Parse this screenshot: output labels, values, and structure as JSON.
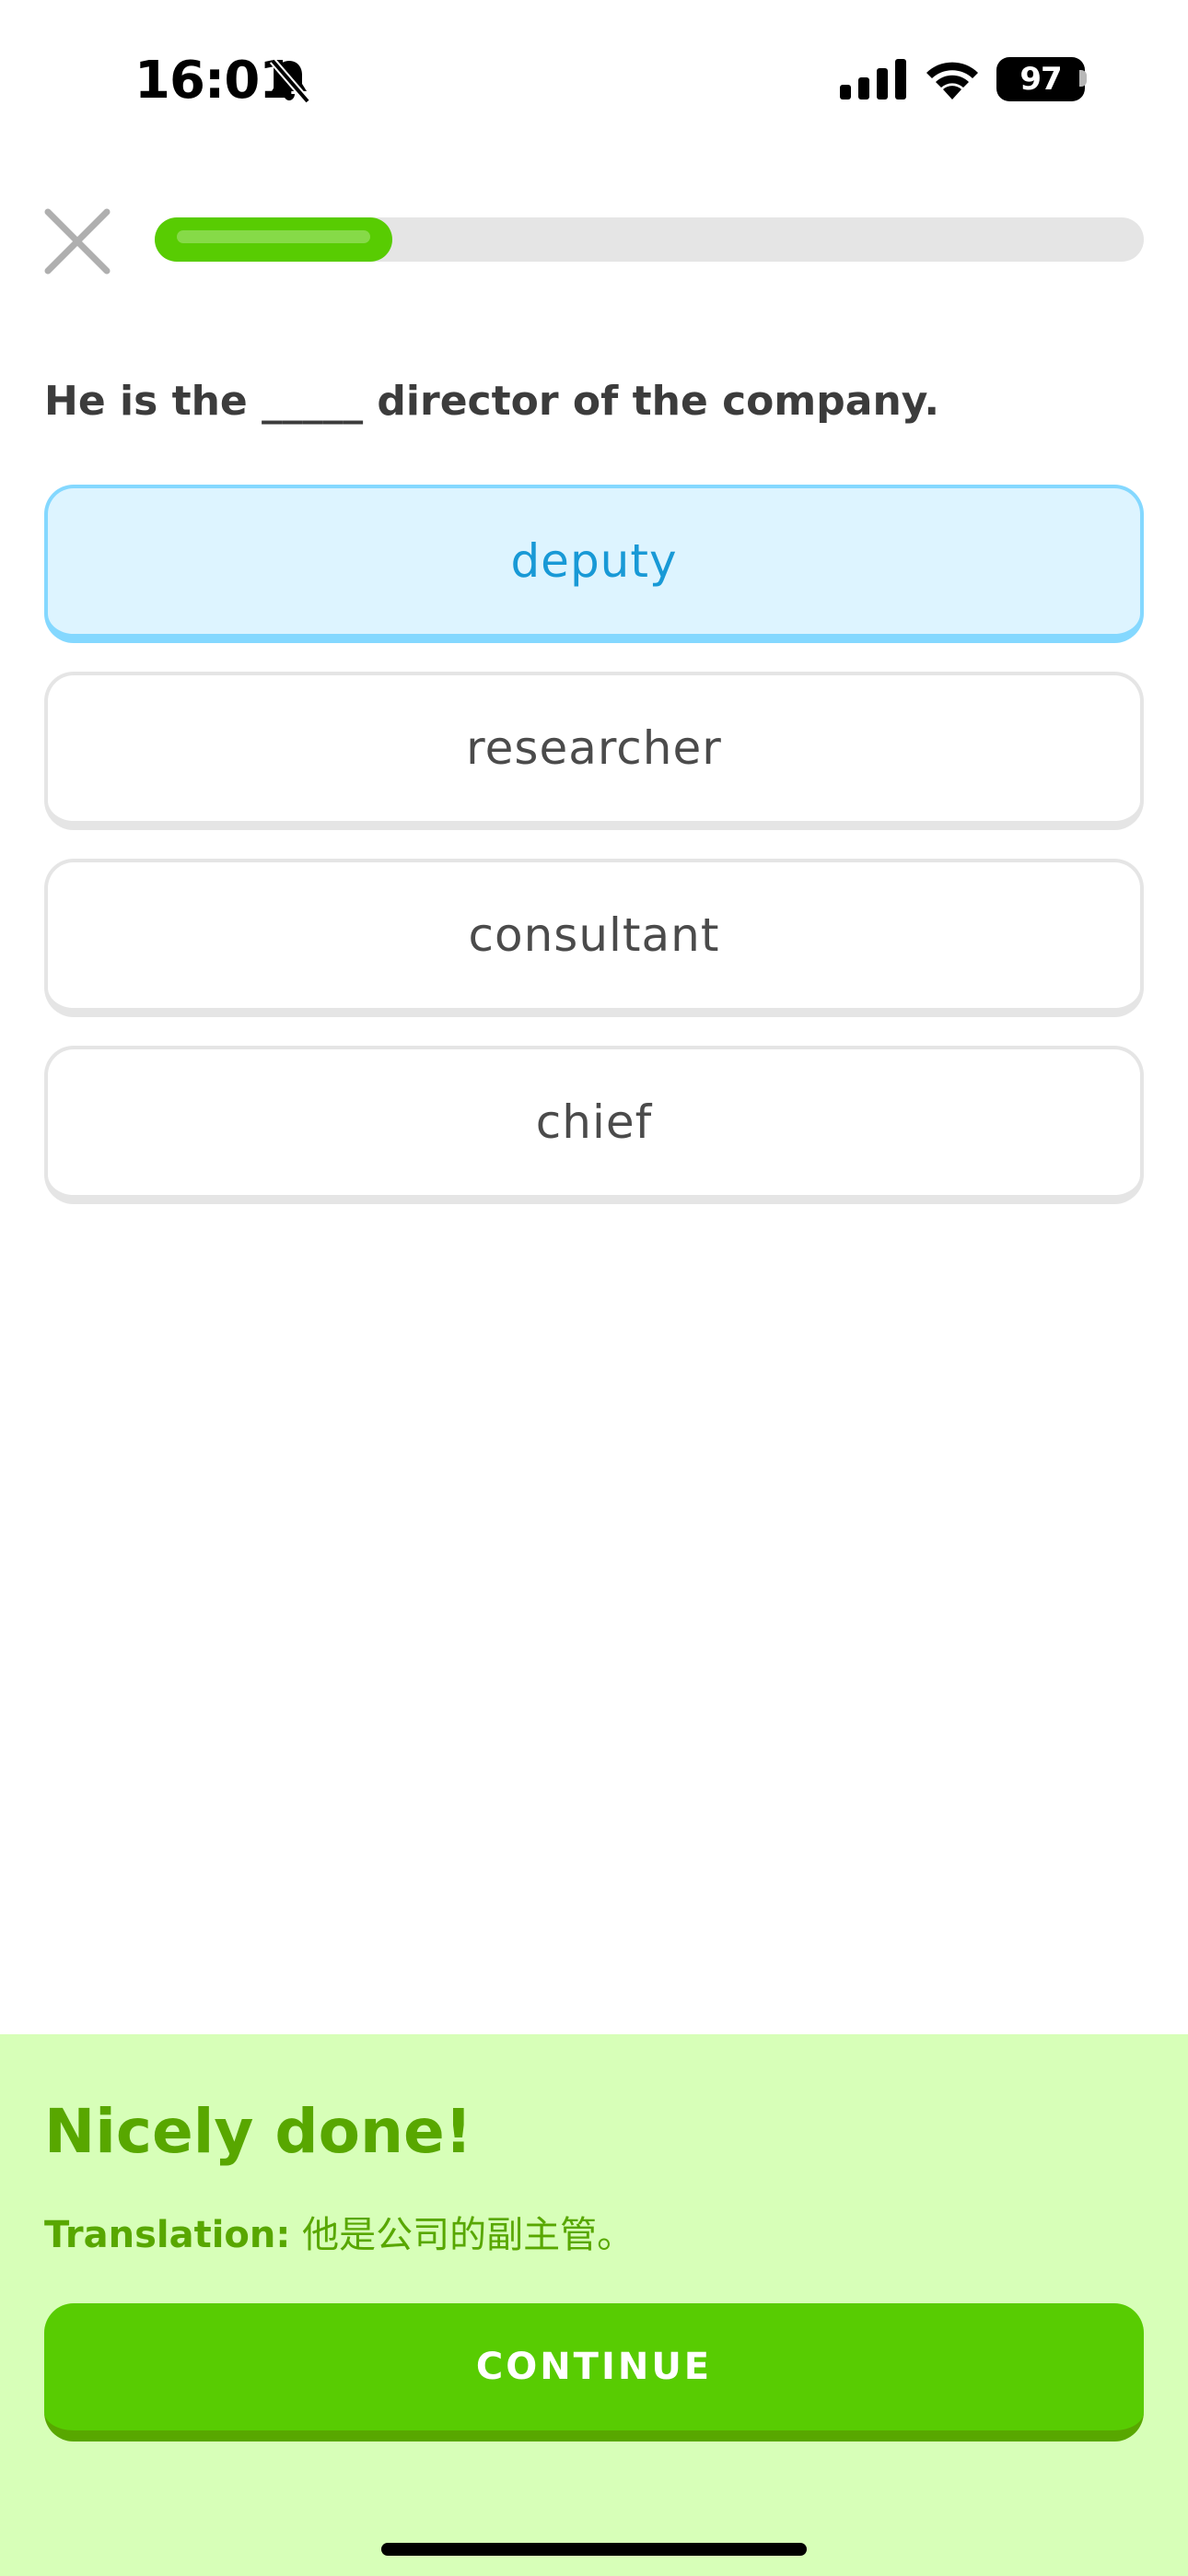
{
  "status_bar": {
    "time": "16:01",
    "battery": "97",
    "icons": [
      "bell-slash-icon",
      "cellular-signal-icon",
      "wifi-icon",
      "battery-icon"
    ]
  },
  "lesson": {
    "progress_fraction": 0.24,
    "question": "He is the _____ director of the company.",
    "options": [
      {
        "label": "deputy",
        "selected": true
      },
      {
        "label": "researcher",
        "selected": false
      },
      {
        "label": "consultant",
        "selected": false
      },
      {
        "label": "chief",
        "selected": false
      }
    ]
  },
  "feedback": {
    "title": "Nicely done!",
    "translation_label": "Translation:",
    "translation_text": "他是公司的副主管。",
    "continue_label": "CONTINUE"
  },
  "colors": {
    "accent_green": "#58cc02",
    "dark_green": "#58a700",
    "feedback_background": "#d7ffb8",
    "selected_blue": "#1899d6",
    "selected_background": "#ddf4ff",
    "selected_border": "#84d8ff"
  }
}
